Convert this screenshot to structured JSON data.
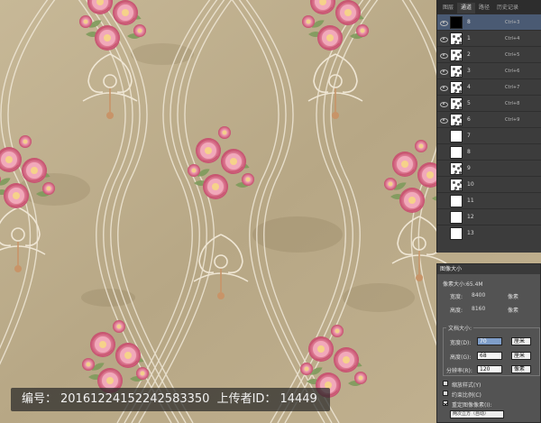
{
  "watermark": {
    "id_label": "编号：",
    "id_value": "20161224152242583350",
    "uploader_label": "上传者ID：",
    "uploader_value": "14449"
  },
  "channels_panel": {
    "tabs": [
      "图层",
      "通道",
      "路径",
      "历史记录"
    ],
    "active_tab": 1,
    "rows": [
      {
        "name": "8",
        "shortcut": "Ctrl+3",
        "thumb": "black",
        "visible": true,
        "selected": true
      },
      {
        "name": "1",
        "shortcut": "Ctrl+4",
        "thumb": "speckle",
        "visible": true,
        "selected": false
      },
      {
        "name": "2",
        "shortcut": "Ctrl+5",
        "thumb": "speckle",
        "visible": true,
        "selected": false
      },
      {
        "name": "3",
        "shortcut": "Ctrl+6",
        "thumb": "speckle",
        "visible": true,
        "selected": false
      },
      {
        "name": "4",
        "shortcut": "Ctrl+7",
        "thumb": "speckle",
        "visible": true,
        "selected": false
      },
      {
        "name": "5",
        "shortcut": "Ctrl+8",
        "thumb": "speckle",
        "visible": true,
        "selected": false
      },
      {
        "name": "6",
        "shortcut": "Ctrl+9",
        "thumb": "speckle",
        "visible": true,
        "selected": false
      },
      {
        "name": "7",
        "shortcut": "",
        "thumb": "white",
        "visible": false,
        "selected": false
      },
      {
        "name": "8",
        "shortcut": "",
        "thumb": "white",
        "visible": false,
        "selected": false
      },
      {
        "name": "9",
        "shortcut": "",
        "thumb": "speckle",
        "visible": false,
        "selected": false
      },
      {
        "name": "10",
        "shortcut": "",
        "thumb": "speckle",
        "visible": false,
        "selected": false
      },
      {
        "name": "11",
        "shortcut": "",
        "thumb": "white",
        "visible": false,
        "selected": false
      },
      {
        "name": "12",
        "shortcut": "",
        "thumb": "white",
        "visible": false,
        "selected": false
      },
      {
        "name": "13",
        "shortcut": "",
        "thumb": "white",
        "visible": false,
        "selected": false
      }
    ]
  },
  "image_size_dialog": {
    "title": "图像大小",
    "pixel_dimensions": "像素大小:65.4M",
    "width_label": "宽度:",
    "width_value": "8400",
    "width_unit": "像素",
    "height_label": "高度:",
    "height_value": "8160",
    "height_unit": "像素",
    "document_size_label": "文档大小:",
    "doc_width_label": "宽度(D):",
    "doc_width_value": "70",
    "doc_width_unit": "厘米",
    "doc_height_label": "高度(G):",
    "doc_height_value": "68",
    "doc_height_unit": "厘米",
    "resolution_label": "分辨率(R):",
    "resolution_value": "120",
    "resolution_unit": "像素",
    "scale_styles_label": "缩放样式(Y)",
    "constrain_label": "约束比例(C)",
    "resample_label": "重定图像像素(I):",
    "resample_method": "两次立方（自动）"
  },
  "colors": {
    "background": "#b9a98b",
    "rose": "#e58aa0",
    "rose_dark": "#c8506e",
    "leaf": "#7e9a5c",
    "ribbon": "#efe7d6",
    "panel": "#3c3c3c",
    "selection": "#4a5a73"
  }
}
